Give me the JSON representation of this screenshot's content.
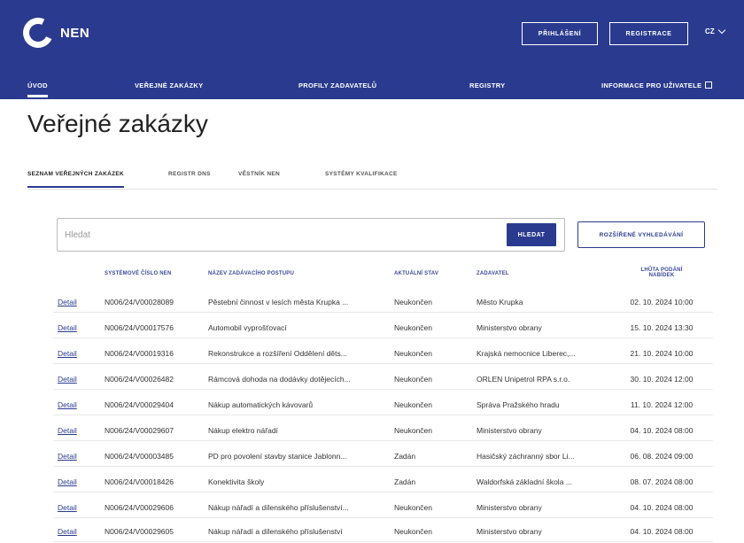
{
  "header": {
    "logo_text": "NEN",
    "login_label": "PŘIHLÁŠENÍ",
    "register_label": "REGISTRACE",
    "language": "CZ",
    "colors": {
      "primary": "#2a3b8f",
      "white": "#ffffff"
    }
  },
  "nav": {
    "items": [
      {
        "label": "ÚVOD"
      },
      {
        "label": "VEŘEJNÉ ZAKÁZKY"
      },
      {
        "label": "PROFILY ZADAVATELŮ"
      },
      {
        "label": "REGISTRY"
      },
      {
        "label": "INFORMACE PRO UŽIVATELE"
      }
    ]
  },
  "page": {
    "title": "Veřejné zakázky"
  },
  "tabs": [
    {
      "label": "SEZNAM VEŘEJNÝCH ZAKÁZEK"
    },
    {
      "label": "REGISTR DNS"
    },
    {
      "label": "VĚSTNÍK NEN"
    },
    {
      "label": "SYSTÉMY KVALIFIKACE"
    }
  ],
  "search": {
    "placeholder": "Hledat",
    "button_label": "HLEDAT",
    "advanced_label": "ROZŠÍŘENÉ VYHLEDÁVÁNÍ"
  },
  "table": {
    "headers": {
      "number": "SYSTÉMOVÉ ČÍSLO NEN",
      "name": "NÁZEV ZADÁVACÍHO POSTUPU",
      "state": "AKTUÁLNÍ STAV",
      "authority": "ZADAVATEL",
      "deadline_1": "LHŮTA PODÁNÍ",
      "deadline_2": "NABÍDEK"
    },
    "rows": [
      {
        "link": "Detail",
        "number": "N006/24/V00028089",
        "name": "Pěstební činnost v lesích města Krupka ...",
        "state": "Neukončen",
        "authority": "Město Krupka",
        "deadline": "02. 10. 2024 10:00"
      },
      {
        "link": "Detail",
        "number": "N006/24/V00017576",
        "name": "Automobil vyprošťovací",
        "state": "Neukončen",
        "authority": "Ministerstvo obrany",
        "deadline": "15. 10. 2024 13:30"
      },
      {
        "link": "Detail",
        "number": "N006/24/V00019316",
        "name": "Rekonstrukce a rozšíření Oddělení děts...",
        "state": "Neukončen",
        "authority": "Krajská nemocnice Liberec,...",
        "deadline": "21. 10. 2024 10:00"
      },
      {
        "link": "Detail",
        "number": "N006/24/V00026482",
        "name": "Rámcová dohoda na dodávky dotějecích...",
        "state": "Neukončen",
        "authority": "ORLEN Unipetrol RPA s.r.o.",
        "deadline": "30. 10. 2024 12:00"
      },
      {
        "link": "Detail",
        "number": "N006/24/V00029404",
        "name": "Nákup automatických kávovarů",
        "state": "Neukončen",
        "authority": "Správa Pražského hradu",
        "deadline": "11. 10. 2024 12:00"
      },
      {
        "link": "Detail",
        "number": "N006/24/V00029607",
        "name": "Nákup elektro nářadí",
        "state": "Neukončen",
        "authority": "Ministerstvo obrany",
        "deadline": "04. 10. 2024 08:00"
      },
      {
        "link": "Detail",
        "number": "N006/24/V00003485",
        "name": "PD pro povolení stavby stanice Jablonn...",
        "state": "Zadán",
        "authority": "Hasičský záchranný sbor Li...",
        "deadline": "06. 08. 2024 09:00"
      },
      {
        "link": "Detail",
        "number": "N006/24/V00018426",
        "name": "Konektivita školy",
        "state": "Zadán",
        "authority": "Waldorfská základní škola ...",
        "deadline": "08. 07. 2024 08:00"
      },
      {
        "link": "Detail",
        "number": "N006/24/V00029606",
        "name": "Nákup nářadí a dílenského příslušenství...",
        "state": "Neukončen",
        "authority": "Ministerstvo obrany",
        "deadline": "04. 10. 2024 08:00"
      },
      {
        "link": "Detail",
        "number": "N006/24/V00029605",
        "name": "Nákup nářadí a dílenského příslušenství",
        "state": "Neukončen",
        "authority": "Ministerstvo obrany",
        "deadline": "04. 10. 2024 08:00"
      }
    ]
  }
}
